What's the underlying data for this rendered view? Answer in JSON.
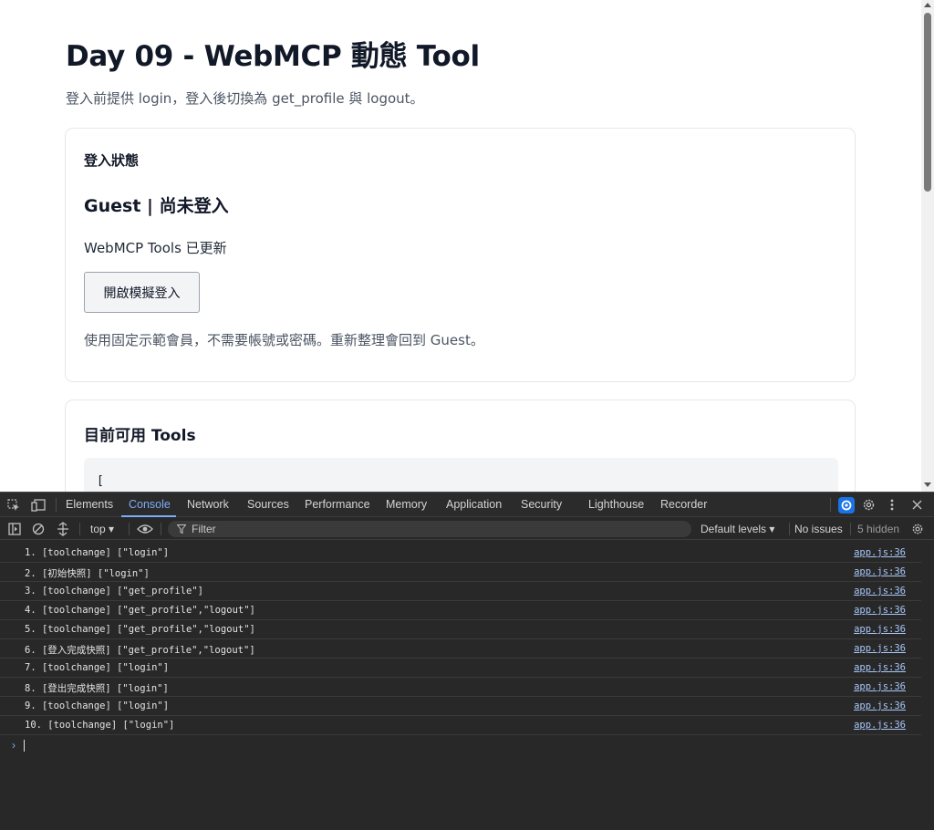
{
  "page": {
    "title": "Day 09 - WebMCP 動態 Tool",
    "subtitle": "登入前提供 login，登入後切換為 get_profile 與 logout。"
  },
  "login_card": {
    "heading": "登入狀態",
    "status": "Guest | 尚未登入",
    "tools_updated": "WebMCP Tools 已更新",
    "button_label": "開啟模擬登入",
    "note": "使用固定示範會員，不需要帳號或密碼。重新整理會回到 Guest。"
  },
  "tools_card": {
    "heading": "目前可用 Tools",
    "code_first_line": "["
  },
  "devtools": {
    "tabs": [
      "Elements",
      "Console",
      "Network",
      "Sources",
      "Performance",
      "Memory",
      "Application",
      "Security",
      "Lighthouse",
      "Recorder"
    ],
    "active_tab": "Console",
    "context": "top ▾",
    "filter_placeholder": "Filter",
    "levels": "Default levels ▾",
    "issues": "No issues",
    "hidden": "5 hidden",
    "accent_color": "#7cacf8"
  },
  "console": {
    "entries": [
      {
        "text": "1. [toolchange] [\"login\"]",
        "source": "app.js:36"
      },
      {
        "text": "2. [初始快照] [\"login\"]",
        "source": "app.js:36"
      },
      {
        "text": "3. [toolchange] [\"get_profile\"]",
        "source": "app.js:36"
      },
      {
        "text": "4. [toolchange] [\"get_profile\",\"logout\"]",
        "source": "app.js:36"
      },
      {
        "text": "5. [toolchange] [\"get_profile\",\"logout\"]",
        "source": "app.js:36"
      },
      {
        "text": "6. [登入完成快照] [\"get_profile\",\"logout\"]",
        "source": "app.js:36"
      },
      {
        "text": "7. [toolchange] [\"login\"]",
        "source": "app.js:36"
      },
      {
        "text": "8. [登出完成快照] [\"login\"]",
        "source": "app.js:36"
      },
      {
        "text": "9. [toolchange] [\"login\"]",
        "source": "app.js:36"
      },
      {
        "text": "10. [toolchange] [\"login\"]",
        "source": "app.js:36"
      }
    ],
    "prompt_symbol": "›"
  }
}
